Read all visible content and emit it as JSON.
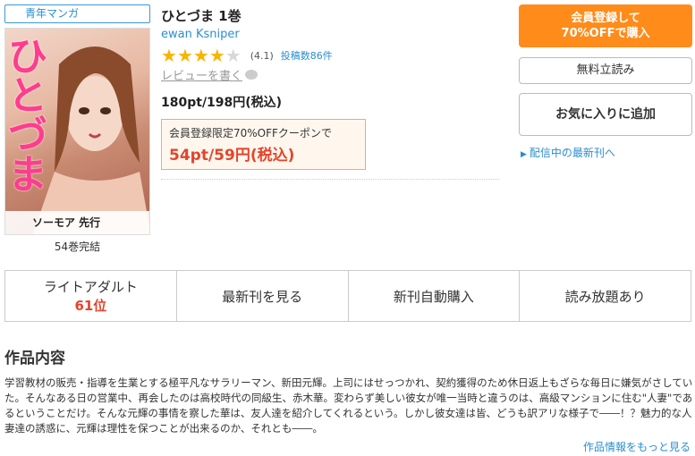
{
  "genre": "青年マンガ",
  "cover": {
    "title_chars": "ひとづま",
    "badge": "ソーモア 先行"
  },
  "volumes_complete": "54巻完結",
  "product": {
    "title": "ひとづま 1巻",
    "author": "ewan Ksniper",
    "rating_value": 4.1,
    "rating_text": "(4.1)",
    "review_count": "投稿数86件",
    "write_review": "レビューを書く",
    "price": "180pt/198円(税込)",
    "coupon_label": "会員登録限定70%OFFクーポンで",
    "coupon_price": "54pt/59円(税込)"
  },
  "buttons": {
    "register_line1": "会員登録して",
    "register_line2": "70%OFFで購入",
    "free_read": "無料立読み",
    "favorite": "お気に入りに追加",
    "latest": "配信中の最新刊へ"
  },
  "stats": {
    "category": "ライトアダルト",
    "rank": "61位",
    "view_latest": "最新刊を見る",
    "auto_buy": "新刊自動購入",
    "unlimited": "読み放題あり"
  },
  "section": {
    "title": "作品内容",
    "description": "学習教材の販売・指導を生業とする極平凡なサラリーマン、新田元輝。上司にはせっつかれ、契約獲得のため休日返上もざらな毎日に嫌気がさしていた。そんなある日の営業中、再会したのは高校時代の同級生、赤木華。変わらず美しい彼女が唯一当時と違うのは、高級マンションに住む\"人妻\"であるということだけ。そんな元輝の事情を察した華は、友人達を紹介してくれるという。しかし彼女達は皆、どうも訳アリな様子で――！？魅力的な人妻達の誘惑に、元輝は理性を保つことが出来るのか、それとも――。",
    "more": "作品情報をもっと見る"
  },
  "colors": {
    "accent_orange": "#ff8c1a",
    "link_blue": "#2a8ed0",
    "price_red": "#e4452b",
    "star": "#f7b500"
  }
}
